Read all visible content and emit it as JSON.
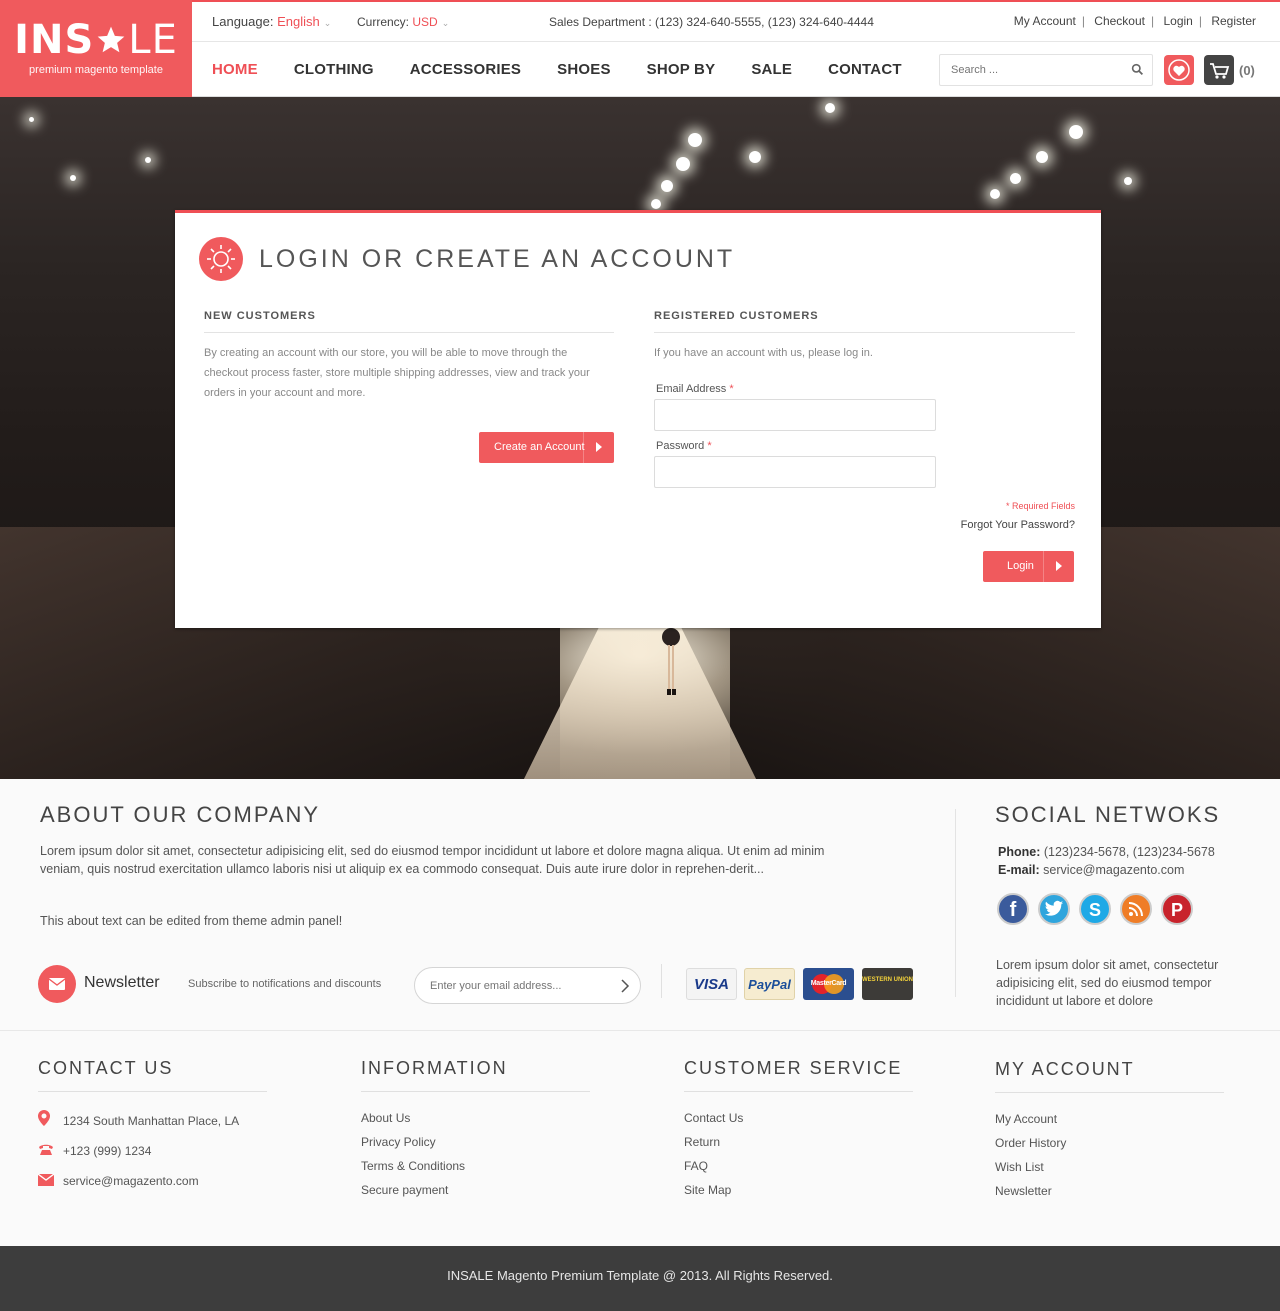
{
  "logo": {
    "brand_left": "INS",
    "brand_right": "LE",
    "tagline": "premium magento template"
  },
  "topbar": {
    "language_label": "Language:",
    "language_value": "English",
    "currency_label": "Currency:",
    "currency_value": "USD",
    "sales": "Sales Department : (123) 324-640-5555, (123) 324-640-4444",
    "links": [
      "My Account",
      "Checkout",
      "Login",
      "Register"
    ]
  },
  "nav": {
    "items": [
      "HOME",
      "CLOTHING",
      "ACCESSORIES",
      "SHOES",
      "SHOP BY",
      "SALE",
      "CONTACT"
    ]
  },
  "search": {
    "placeholder": "Search ..."
  },
  "cart": {
    "count": "(0)"
  },
  "login": {
    "title": "LOGIN OR CREATE AN ACCOUNT",
    "new_heading": "NEW CUSTOMERS",
    "new_text": "By creating an account with our store, you will be able to move through the checkout process faster, store multiple shipping addresses, view and track your orders in your account and more.",
    "create_button": "Create an Account",
    "reg_heading": "REGISTERED CUSTOMERS",
    "reg_text": "If you have an account with us, please log in.",
    "email_label": "Email Address",
    "password_label": "Password",
    "required_mark": "*",
    "required_note": "* Required Fields",
    "forgot": "Forgot Your Password?",
    "login_button": "Login"
  },
  "about": {
    "title": "ABOUT OUR COMPANY",
    "text": "Lorem ipsum dolor sit amet, consectetur adipisicing elit, sed do eiusmod tempor incididunt ut labore et dolore magna aliqua. Ut enim ad minim veniam, quis nostrud exercitation ullamco laboris nisi ut aliquip ex ea commodo consequat. Duis aute irure dolor in reprehen-derit...",
    "text2": "This about text can be edited from theme admin panel!"
  },
  "newsletter": {
    "title": "Newsletter",
    "subtitle": "Subscribe to notifications and discounts",
    "placeholder": "Enter your email address..."
  },
  "payments": [
    "VISA",
    "PayPal",
    "MasterCard",
    "WESTERN UNION"
  ],
  "social": {
    "title": "SOCIAL NETWOKS",
    "phone_label": "Phone:",
    "phone": "(123)234-5678, (123)234-5678",
    "email_label": "E-mail:",
    "email": "service@magazento.com",
    "icons": [
      "facebook-icon",
      "twitter-icon",
      "skype-icon",
      "rss-icon",
      "pinterest-icon"
    ],
    "text": "Lorem ipsum dolor sit amet, consectetur adipisicing elit, sed do eiusmod tempor incididunt ut labore et dolore"
  },
  "footer": {
    "contact": {
      "title": "CONTACT US",
      "address": "1234 South Manhattan Place, LA",
      "phone": "+123 (999) 1234",
      "email": "service@magazento.com"
    },
    "information": {
      "title": "INFORMATION",
      "items": [
        "About Us",
        "Privacy Policy",
        "Terms & Conditions",
        "Secure payment"
      ]
    },
    "customer_service": {
      "title": "CUSTOMER SERVICE",
      "items": [
        "Contact Us",
        "Return",
        "FAQ",
        "Site Map"
      ]
    },
    "my_account": {
      "title": "MY ACCOUNT",
      "items": [
        "My Account",
        "Order History",
        "Wish List",
        "Newsletter"
      ]
    },
    "copyright": "INSALE Magento Premium Template @ 2013. All Rights Reserved."
  },
  "colors": {
    "accent": "#ef4f55",
    "dark": "#3d3d3d"
  }
}
